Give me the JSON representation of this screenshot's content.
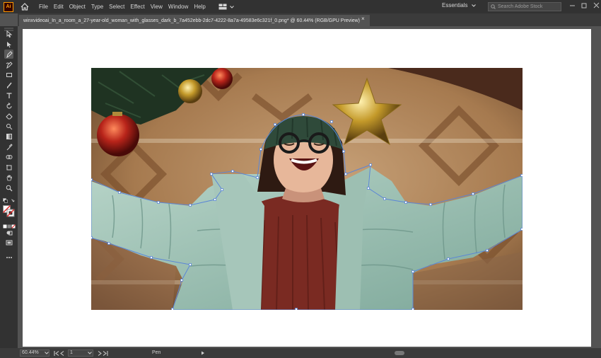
{
  "app": {
    "logo_text": "Ai"
  },
  "menubar": {
    "items": [
      "File",
      "Edit",
      "Object",
      "Type",
      "Select",
      "Effect",
      "View",
      "Window",
      "Help"
    ],
    "workspace": "Essentials",
    "search_placeholder": "Search Adobe Stock"
  },
  "document": {
    "tab_title": "winxvideoai_In_a_room_a_27-year-old_woman_with_glasses_dark_b_7a452ebb-2dc7-4222-8a7a-49583e6c321f_0.png* @ 60.44% (RGB/GPU Preview)",
    "tab_close": "×"
  },
  "tools": [
    "selection-tool",
    "direct-selection-tool",
    "pen-tool",
    "curvature-tool",
    "rectangle-tool",
    "paintbrush-tool",
    "type-tool",
    "rotate-tool",
    "eraser-tool",
    "warp-tool",
    "gradient-tool",
    "eyedropper-tool",
    "shape-builder-tool",
    "artboard-tool",
    "zoom-tool",
    "fill-stroke",
    "draw-mode",
    "screen-mode",
    "more-tools"
  ],
  "status": {
    "zoom": "60.44%",
    "page": "1",
    "tool_name": "Pen"
  },
  "colors": {
    "accent": "#4a90e2",
    "path": "#5b86d6",
    "jacket": "#9bbfb3",
    "sweater": "#7a2a22",
    "rug": "#b88a5c"
  }
}
